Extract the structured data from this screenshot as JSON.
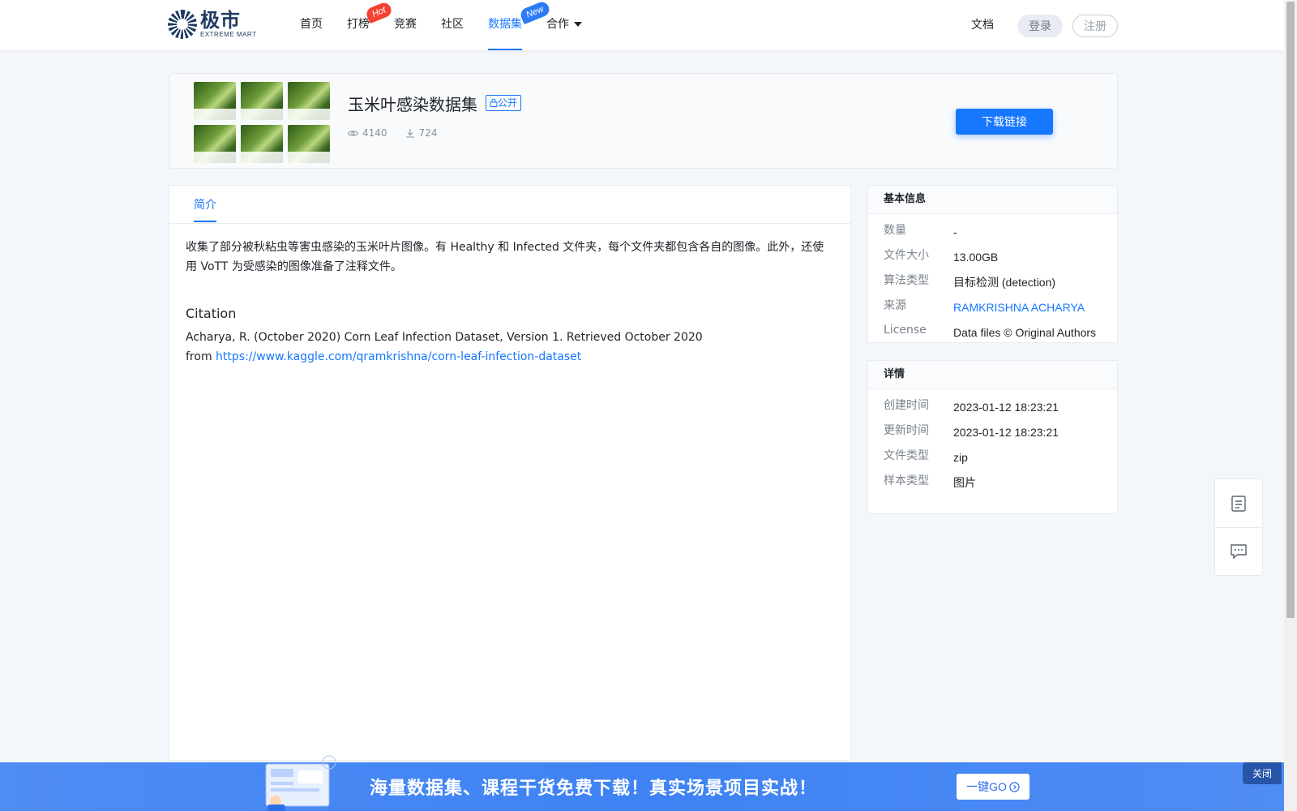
{
  "brand": {
    "name_cn": "极市",
    "name_en": "EXTREME MART"
  },
  "nav": {
    "items": [
      {
        "label": "首页"
      },
      {
        "label": "打榜",
        "badge": "Hot"
      },
      {
        "label": "竞赛"
      },
      {
        "label": "社区"
      },
      {
        "label": "数据集",
        "badge": "New",
        "active": true
      },
      {
        "label": "合作"
      }
    ],
    "docs": "文档",
    "login": "登录",
    "register": "注册"
  },
  "dataset": {
    "title": "玉米叶感染数据集",
    "visibility": "公开",
    "views": "4140",
    "downloads": "724",
    "download_button": "下载链接"
  },
  "intro": {
    "tab": "简介",
    "description": "收集了部分被秋粘虫等害虫感染的玉米叶片图像。有 Healthy 和 Infected 文件夹，每个文件夹都包含各自的图像。此外，还使用 VoTT 为受感染的图像准备了注释文件。",
    "citation_heading": "Citation",
    "citation_text": "Acharya, R. (October 2020) Corn Leaf Infection Dataset, Version 1. Retrieved October 2020",
    "citation_from": "from",
    "citation_url": "https://www.kaggle.com/qramkrishna/corn-leaf-infection-dataset"
  },
  "basic_info": {
    "heading": "基本信息",
    "rows": [
      {
        "k": "数量",
        "v": "-"
      },
      {
        "k": "文件大小",
        "v": "13.00GB"
      },
      {
        "k": "算法类型",
        "v": "目标检测 (detection)"
      },
      {
        "k": "来源",
        "v": "RAMKRISHNA ACHARYA"
      },
      {
        "k": "License",
        "v": "Data files © Original Authors"
      }
    ]
  },
  "details": {
    "heading": "详情",
    "rows": [
      {
        "k": "创建时间",
        "v": "2023-01-12 18:23:21"
      },
      {
        "k": "更新时间",
        "v": "2023-01-12 18:23:21"
      },
      {
        "k": "文件类型",
        "v": "zip"
      },
      {
        "k": "样本类型",
        "v": "图片"
      }
    ]
  },
  "promo": {
    "text": "海量数据集、课程干货免费下载！真实场景项目实战！",
    "button": "一键GO",
    "close": "关闭"
  },
  "colors": {
    "accent": "#1677ff",
    "hot": "#f5412f",
    "new": "#2b7bf6",
    "banner": "#3e82f3"
  },
  "icons": [
    "eye-icon",
    "download-icon",
    "lock-icon",
    "document-icon",
    "feedback-icon",
    "chevron-down-icon",
    "arrow-circle-icon"
  ]
}
